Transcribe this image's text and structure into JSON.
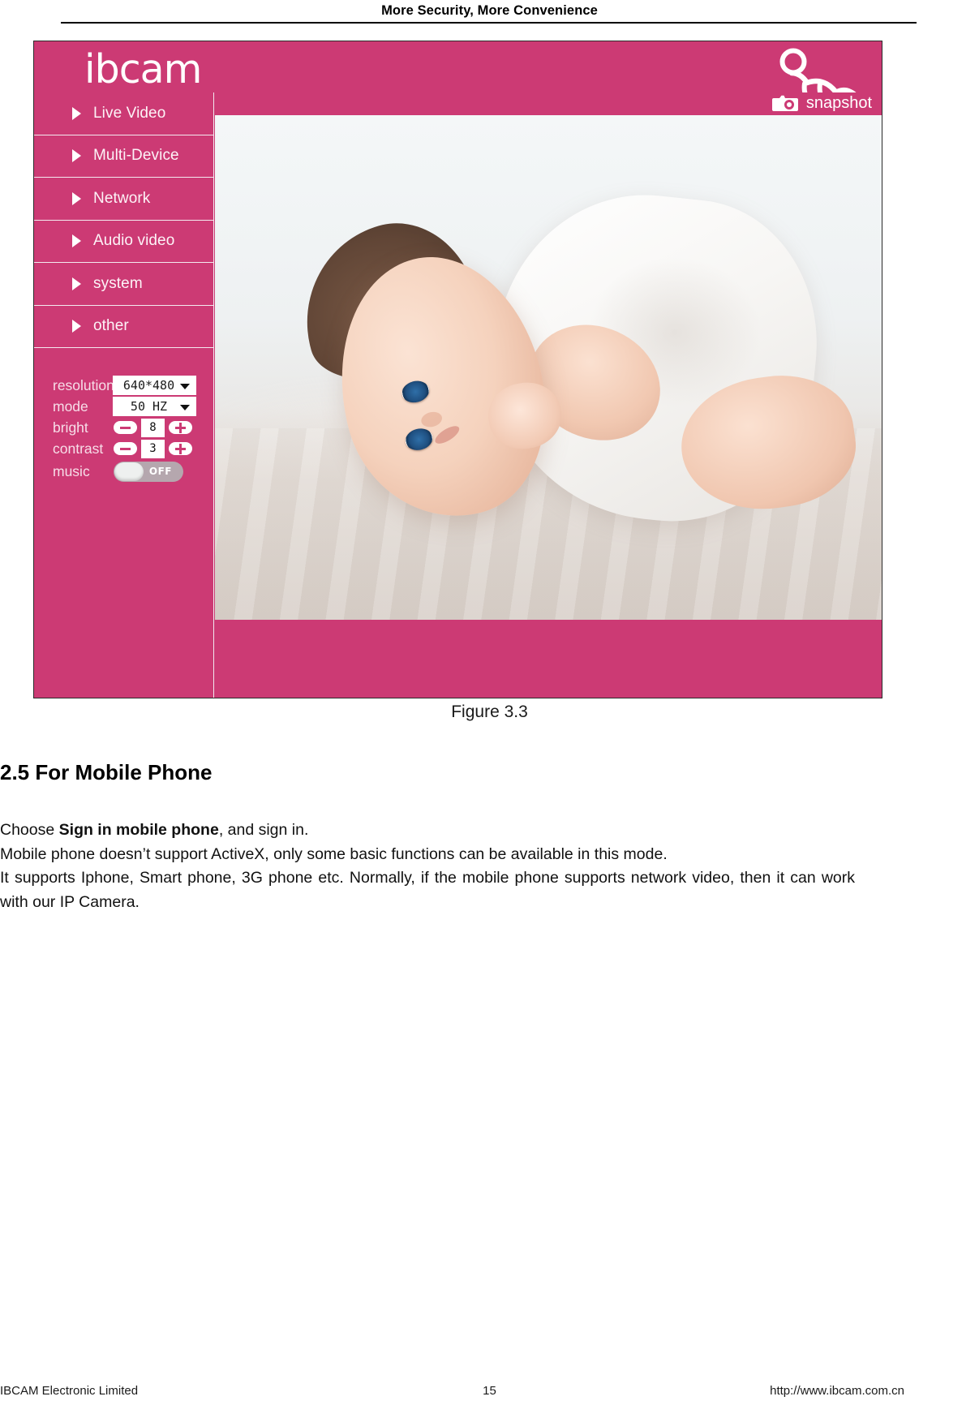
{
  "page_header": {
    "title": "More Security, More Convenience"
  },
  "figure": {
    "caption": "Figure 3.3",
    "brand_logo": "ibcam",
    "baby_icon": "crawling-baby-icon",
    "snapshot": {
      "label": "snapshot",
      "icon": "camera-icon"
    },
    "menu": [
      {
        "label": "Live Video",
        "icon": "play-triangle-icon"
      },
      {
        "label": "Multi-Device",
        "icon": "play-triangle-icon"
      },
      {
        "label": "Network",
        "icon": "play-triangle-icon"
      },
      {
        "label": "Audio video",
        "icon": "play-triangle-icon"
      },
      {
        "label": "system",
        "icon": "play-triangle-icon"
      },
      {
        "label": "other",
        "icon": "play-triangle-icon"
      }
    ],
    "controls": {
      "resolution": {
        "label": "resolution",
        "value": "640*480"
      },
      "mode": {
        "label": "mode",
        "value": "50 HZ"
      },
      "bright": {
        "label": "bright",
        "value": "8",
        "minus": "minus-icon",
        "plus": "plus-icon"
      },
      "contrast": {
        "label": "contrast",
        "value": "3",
        "minus": "minus-icon",
        "plus": "plus-icon"
      },
      "music": {
        "label": "music",
        "state": "OFF"
      }
    },
    "colors": {
      "brand_pink": "#CC3A74",
      "panel_border": "#F4EAF0",
      "toggle_track": "#B5A7AE"
    }
  },
  "section": {
    "heading": "2.5 For Mobile Phone"
  },
  "body": {
    "line1_prefix": "Choose ",
    "line1_bold": "Sign in mobile phone",
    "line1_suffix": ", and sign in.",
    "line2": "Mobile phone doesn’t support ActiveX, only some basic functions can be available in this mode.",
    "line3": "It supports Iphone, Smart phone, 3G phone etc. Normally, if the mobile phone supports network video, then it can work with our IP Camera."
  },
  "footer": {
    "left": "IBCAM Electronic Limited",
    "page": "15",
    "right": "http://www.ibcam.com.cn"
  }
}
